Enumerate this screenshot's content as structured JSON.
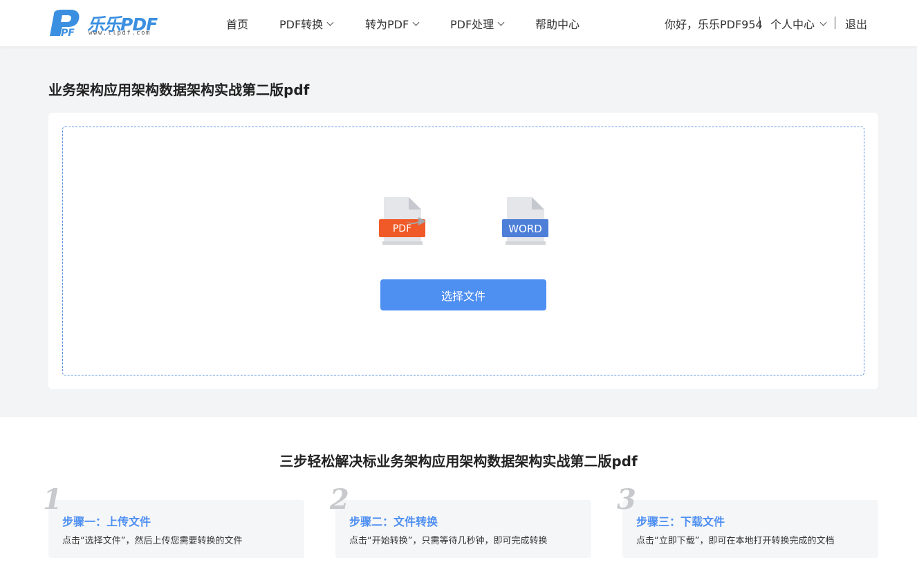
{
  "header": {
    "logo_text": "乐乐PDF",
    "logo_url": "www.llpdf.com",
    "nav": [
      {
        "label": "首页",
        "has_dropdown": false
      },
      {
        "label": "PDF转换",
        "has_dropdown": true
      },
      {
        "label": "转为PDF",
        "has_dropdown": true
      },
      {
        "label": "PDF处理",
        "has_dropdown": true
      },
      {
        "label": "帮助中心",
        "has_dropdown": false
      }
    ],
    "greeting": "你好，乐乐PDF954",
    "user_center": "个人中心",
    "logout": "退出"
  },
  "main": {
    "title": "业务架构应用架构数据架构实战第二版pdf",
    "source_format": "PDF",
    "target_format": "WORD",
    "select_button": "选择文件"
  },
  "steps_section": {
    "title": "三步轻松解决标业务架构应用架构数据架构实战第二版pdf",
    "steps": [
      {
        "num": "1",
        "title": "步骤一：上传文件",
        "desc": "点击“选择文件”，然后上传您需要转换的文件"
      },
      {
        "num": "2",
        "title": "步骤二：文件转换",
        "desc": "点击“开始转换”，只需等待几秒钟，即可完成转换"
      },
      {
        "num": "3",
        "title": "步骤三：下载文件",
        "desc": "点击“立即下载”，即可在本地打开转换完成的文档"
      }
    ]
  },
  "colors": {
    "accent": "#4e8ff2",
    "pdf_badge": "#f05a28",
    "word_badge": "#4d7fd8",
    "page_bg": "#f3f4f6"
  }
}
